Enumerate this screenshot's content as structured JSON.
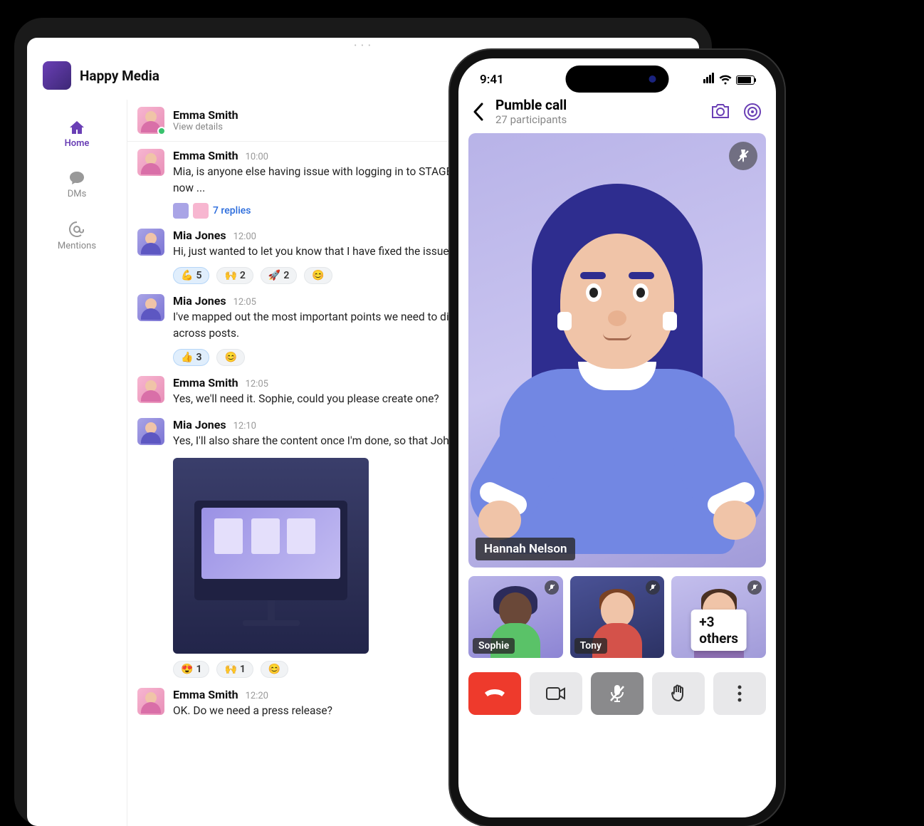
{
  "workspace": {
    "title": "Happy Media"
  },
  "sidebar": {
    "items": [
      {
        "label": "Home"
      },
      {
        "label": "DMs"
      },
      {
        "label": "Mentions"
      }
    ]
  },
  "channel": {
    "name": "Emma Smith",
    "subtitle": "View details"
  },
  "messages": [
    {
      "author": "Emma Smith",
      "time": "10:00",
      "text": "Mia, is anyone else having issue with logging in to STAGE? Prod is fine, but I am being asked for a token now ...",
      "avatar": "pink",
      "thread": {
        "replies_text": "7 replies"
      }
    },
    {
      "author": "Mia Jones",
      "time": "12:00",
      "text": "Hi, just wanted to let you know that I have fixed the issue that we could move the ticket to \"Done\". 🙂",
      "avatar": "purple",
      "reactions": [
        {
          "emoji": "💪",
          "count": "5",
          "active": true
        },
        {
          "emoji": "🙌",
          "count": "2"
        },
        {
          "emoji": "🚀",
          "count": "2"
        },
        {
          "emoji": "😊",
          "add": true
        }
      ]
    },
    {
      "author": "Mia Jones",
      "time": "12:05",
      "text": "I've mapped out the most important points we need to discuss will make sure that message is consistent across posts.",
      "avatar": "purple",
      "reactions": [
        {
          "emoji": "👍",
          "count": "3",
          "active": true
        },
        {
          "emoji": "😊",
          "add": true
        }
      ]
    },
    {
      "author": "Emma Smith",
      "time": "12:05",
      "text": "Yes, we'll need it. Sophie, could you please create one?",
      "avatar": "pink"
    },
    {
      "author": "Mia Jones",
      "time": "12:10",
      "text": "Yes, I'll also share the content once I'm done, so that John can brand. 👍",
      "avatar": "purple",
      "attachment": true,
      "reactions": [
        {
          "emoji": "😍",
          "count": "1"
        },
        {
          "emoji": "🙌",
          "count": "1"
        },
        {
          "emoji": "😊",
          "add": true
        }
      ]
    },
    {
      "author": "Emma Smith",
      "time": "12:20",
      "text": "OK. Do we need a press release?",
      "avatar": "pink"
    }
  ],
  "phone": {
    "status_time": "9:41",
    "call_title": "Pumble call",
    "participants_text": "27 participants",
    "active_speaker": "Hannah Nelson",
    "thumbnails": [
      {
        "name": "Sophie"
      },
      {
        "name": "Tony"
      },
      {
        "name_overlay": "+3 others"
      }
    ]
  }
}
